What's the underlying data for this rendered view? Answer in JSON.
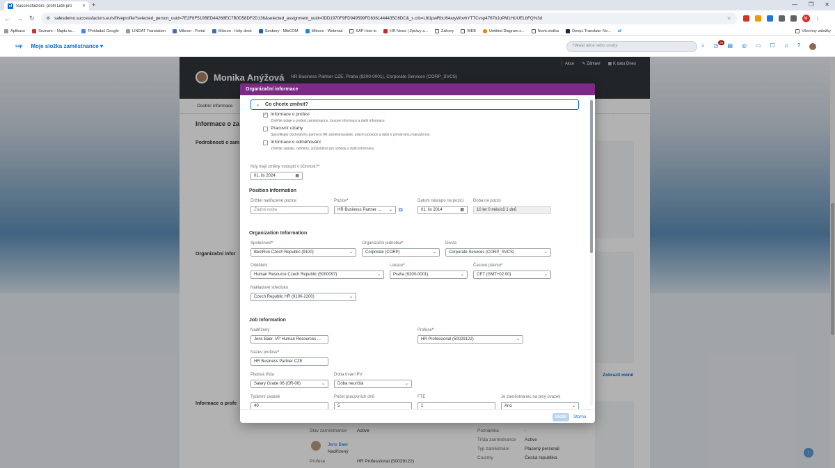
{
  "browser": {
    "tab_title": "Successfactors: profil Lidé pro",
    "tab_favicon": "sf",
    "new_tab": "+",
    "url": "salesdemo.successfactors.eu/sf/liveprofile?selected_person_uuid=7E2F8F510BED44268EC7B0D58DF2D136&selected_assignment_uuid=0DD1970F9FD949599FD6361444435C6DC&_s.crb=L8l1pwRbU64aryWovhYTTCvsp4787bJuPM1HUUELbFQ%3d",
    "profile_initial": "M",
    "bookmarks": [
      "Aplikace",
      "Seznam – Najdu ta...",
      "Překladač Google",
      "LINDAT Translation",
      "Mibcon - Portal",
      "Mibcon - Help desk",
      "Soubory - MibCOM",
      "Mibcon - Webmail",
      "SAP How to",
      "HR News | Zprávy a...",
      "Zákony",
      "WEB",
      "Untitled Diagram.x...",
      "Nová složka",
      "DeepL Translate: Ne...",
      "sf"
    ],
    "bookmarks_right": "Všechny záložky"
  },
  "shell": {
    "logo": "sap",
    "home_label": "Moje složka zaměstnance ▾",
    "search_placeholder": "Hledat akce nebo osoby",
    "notification_count": "29"
  },
  "profile": {
    "name": "Monika Anýžová",
    "subtitle": "HR Business Partner CZE, Praha (9200-0001), Corporate Services (CORP_SVCS)",
    "actions": [
      "Akce",
      "Záhlaví",
      "K datu Dnes"
    ],
    "tab": "Osobní informace",
    "section_title": "Informace o za",
    "details_title": "Podrobnosti o zam",
    "org_title": "Organizační infor",
    "job_title": "Informace o profe",
    "more_link": "Zobrazit méně"
  },
  "bg_fields": {
    "employment_status_key": "Stav zaměstnance",
    "employment_status_value": "Active",
    "manager_name": "Jens Baer",
    "manager_role": "Nadřízený",
    "profession_key": "Profese",
    "profession_value": "HR Professional (50029122)",
    "note_key": "Poznámka",
    "note_value": "-",
    "class_key": "Třída zaměstnance",
    "class_value": "Active",
    "type_key": "Typ zaměstnání",
    "type_value": "Placený personál",
    "country_key": "Country",
    "country_value": "Česká republika"
  },
  "dialog": {
    "title": "Organizační informace",
    "question": "Co chcete změnit?",
    "options": [
      {
        "label": "Informace o profesi",
        "desc": "Změňte údaje o profesi zaměstnance, časové informace a další informace.",
        "checked": true
      },
      {
        "label": "Pracovní vztahy",
        "desc": "Specifikujte obchodního partnera HR zaměstnavatele, právní poradce a další k primárnímu manažerovi.",
        "checked": false
      },
      {
        "label": "Informace o odměňování",
        "desc": "Změňte výplatu, odměnu, způsobilost pro výhody a další informace.",
        "checked": false
      }
    ],
    "effective_label": "Kdy mají změny vstoupit v účinnost?",
    "effective_value": "01. lis 2024",
    "position_header": "Position Information",
    "holder_label": "Držitel nadřazené pozice",
    "holder_placeholder": "Žádná volba",
    "position_label": "Pozice",
    "position_value": "HR Business Partner ...",
    "entry_date_label": "Datum nástupu na pozici",
    "entry_date_value": "01. lis 2014",
    "duration_label": "Doba na pozici",
    "duration_value": "10 let 0 měsíců 1 dnů",
    "org_header": "Organization Information",
    "company_label": "Společnost",
    "company_value": "BestRun Czech Republic (9100)",
    "unit_label": "Organizační jednotka",
    "unit_value": "Corporate (CORP)",
    "division_label": "Divize",
    "division_value": "Corporate Services (CORP_SVCS)",
    "dept_label": "Oddělení",
    "dept_value": "Human Resource Czech Republic (5000097)",
    "location_label": "Lokace",
    "location_value": "Praha (9200-0001)",
    "tz_label": "Časové pásmo",
    "tz_value": "CET (GMT+02:00)",
    "cost_label": "Nákladové středisko",
    "cost_value": "Czech Republic  HR (9100-2200)",
    "job_header": "Job Information",
    "superior_label": "Nadřízený",
    "superior_value": "Jens Baer, VP Human Resources ...",
    "profession_label": "Profese",
    "profession_value": "HR Professional (50029122)",
    "jobname_label": "Název profese",
    "jobname_value": "HR Business Partner CZE",
    "pay_label": "Platová třída",
    "pay_value": "Salary Grade 06 (GR-06)",
    "contract_label": "Doba trvání PV",
    "contract_value": "Doba neurčitá",
    "hours_label": "Týdenní úvazek",
    "hours_value": "40",
    "days_label": "Počet pracovních dnů",
    "days_value": "5",
    "fte_label": "FTE",
    "fte_value": "1",
    "fulltime_label": "Je zaměstnanec na plný úvazek",
    "fulltime_value": "Ano",
    "save_label": "Uložit",
    "cancel_label": "Storno"
  }
}
